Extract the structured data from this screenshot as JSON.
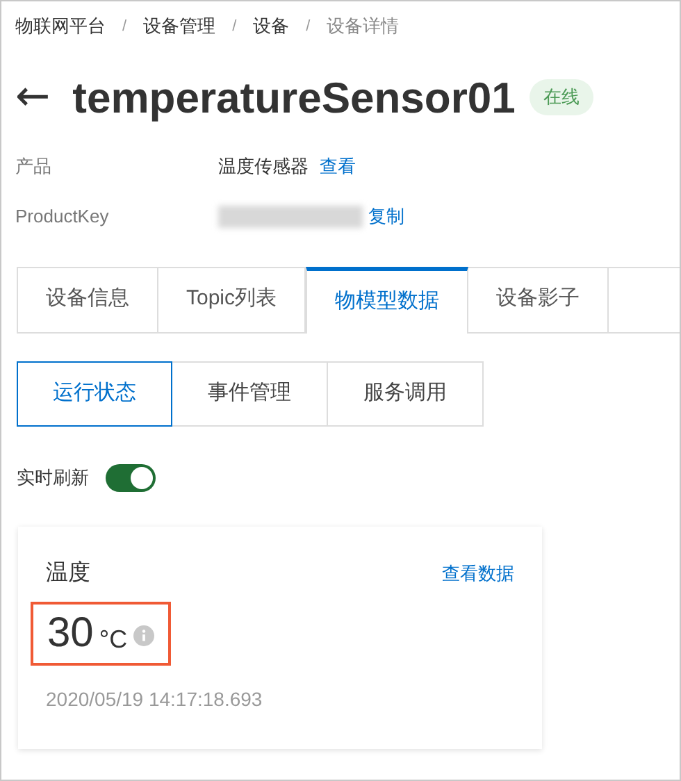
{
  "breadcrumb": [
    {
      "label": "物联网平台",
      "current": false
    },
    {
      "label": "设备管理",
      "current": false
    },
    {
      "label": "设备",
      "current": false
    },
    {
      "label": "设备详情",
      "current": true
    }
  ],
  "breadcrumb_separator": "/",
  "back_arrow": "←",
  "device": {
    "name": "temperatureSensor01",
    "status": "在线",
    "online": true
  },
  "info": [
    {
      "label": "产品",
      "value": "温度传感器",
      "link": "查看",
      "redacted": false
    },
    {
      "label": "ProductKey",
      "link": "复制",
      "redacted": true
    }
  ],
  "tabs": [
    {
      "label": "设备信息",
      "selected": false
    },
    {
      "label": "Topic列表",
      "selected": false
    },
    {
      "label": "物模型数据",
      "selected": true
    },
    {
      "label": "设备影子",
      "selected": false
    }
  ],
  "subtabs": [
    {
      "label": "运行状态",
      "selected": true
    },
    {
      "label": "事件管理",
      "selected": false
    },
    {
      "label": "服务调用",
      "selected": false
    }
  ],
  "refresh": {
    "label": "实时刷新",
    "on": true
  },
  "properties": [
    {
      "name": "温度",
      "link": "查看数据",
      "value": "30",
      "unit": "°C",
      "highlighted": true,
      "timestamp": "2020/05/19 14:17:18.693"
    }
  ]
}
